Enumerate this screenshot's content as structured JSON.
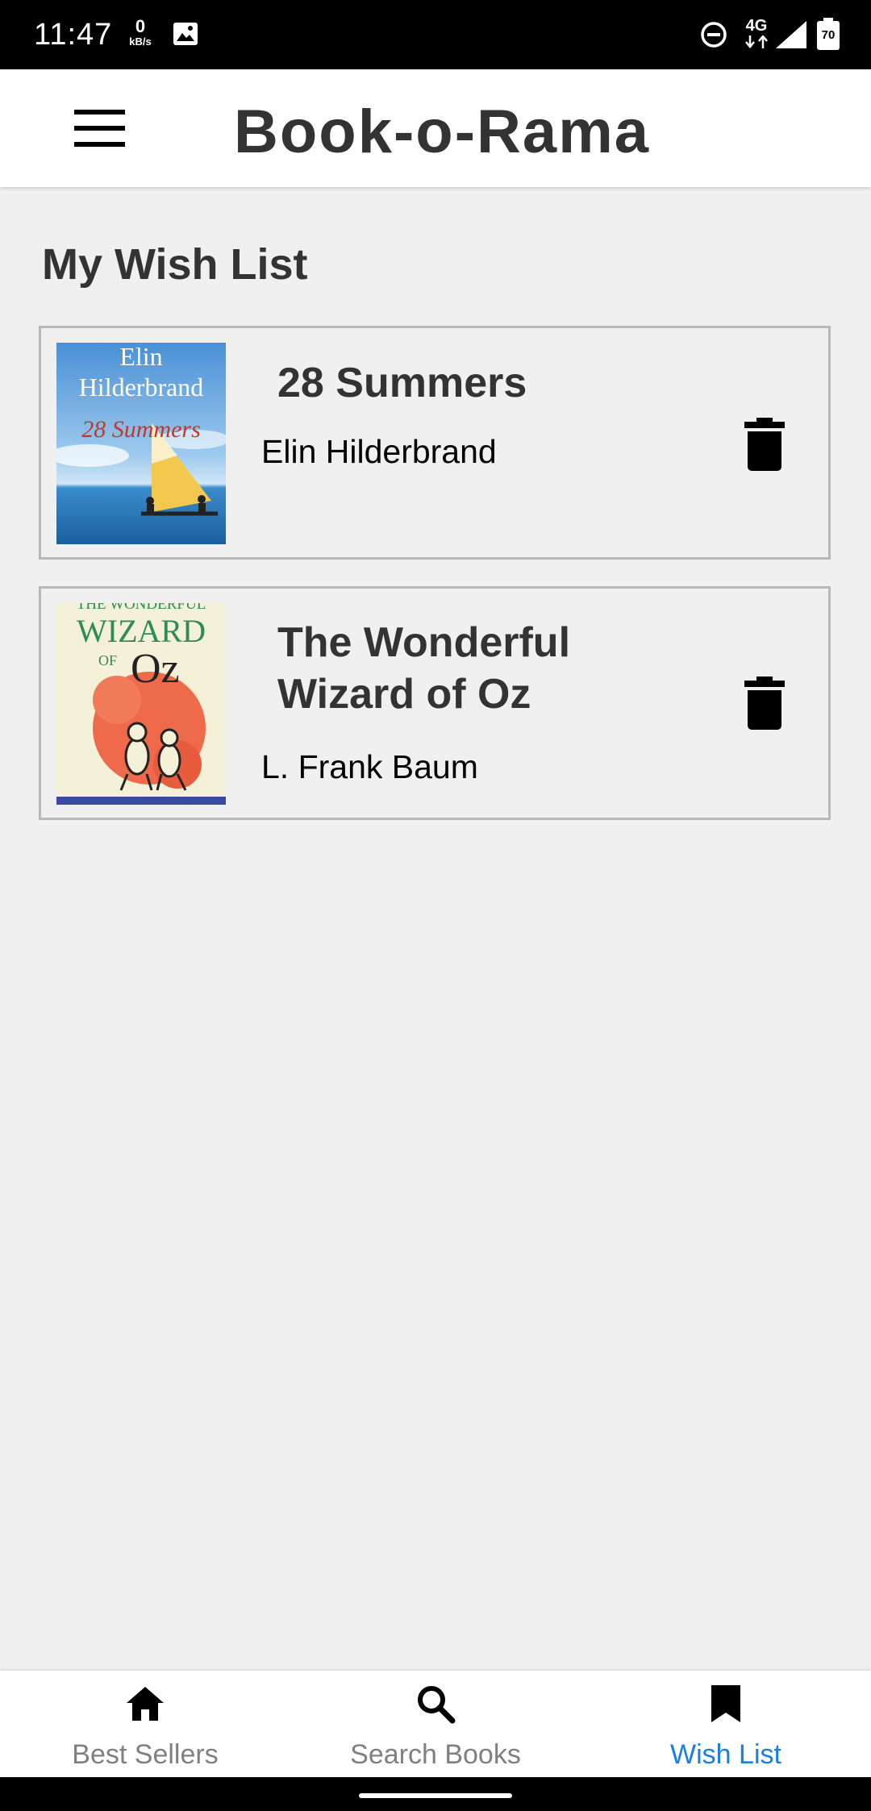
{
  "status_bar": {
    "time": "11:47",
    "speed_value": "0",
    "speed_unit": "kB/s",
    "network": "4G",
    "battery": "70"
  },
  "app_bar": {
    "title": "Book-o-Rama"
  },
  "page": {
    "title": "My Wish List"
  },
  "books": [
    {
      "title": "28 Summers",
      "author": "Elin Hilderbrand",
      "cover": {
        "author_line1": "Elin",
        "author_line2": "Hilderbrand",
        "title": "28 Summers"
      }
    },
    {
      "title": "The Wonderful Wizard of Oz",
      "author": "L. Frank Baum",
      "cover": {
        "line1": "THE WONDERFUL",
        "line2": "WIZARD",
        "line3": "OF",
        "line4": "Oz"
      }
    }
  ],
  "bottom_nav": {
    "items": [
      {
        "label": "Best Sellers",
        "icon": "home-icon",
        "active": false
      },
      {
        "label": "Search Books",
        "icon": "search-icon",
        "active": false
      },
      {
        "label": "Wish List",
        "icon": "bookmark-icon",
        "active": true
      }
    ]
  },
  "colors": {
    "background": "#f0f0f0",
    "app_bar": "#ffffff",
    "text": "#333333",
    "active_tab": "#1a7fe0",
    "inactive_tab": "#808080",
    "card_border": "#b8b8b8"
  }
}
